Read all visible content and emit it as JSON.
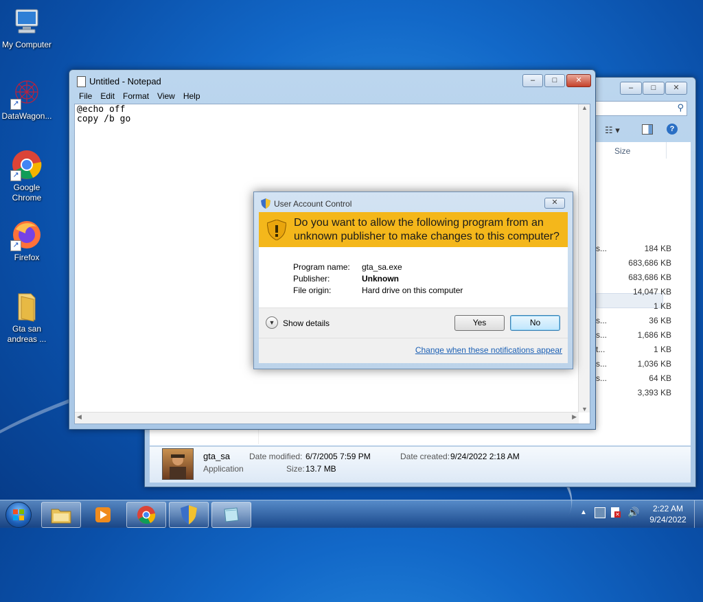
{
  "desktop": {
    "icons": [
      {
        "label": "My Computer",
        "icon": "computer-icon"
      },
      {
        "label": "DataWagon...",
        "icon": "datawagon-icon"
      },
      {
        "label": "Google Chrome",
        "icon": "chrome-icon"
      },
      {
        "label": "Firefox",
        "icon": "firefox-icon"
      },
      {
        "label": "Gta san andreas ...",
        "icon": "folder-icon"
      }
    ]
  },
  "notepad": {
    "title": "Untitled - Notepad",
    "menu": [
      "File",
      "Edit",
      "Format",
      "View",
      "Help"
    ],
    "content": "@echo off\ncopy /b go"
  },
  "explorer": {
    "column_size": "Size",
    "rows": [
      {
        "prefix": "s...",
        "size": "184 KB"
      },
      {
        "prefix": "",
        "size": "683,686 KB"
      },
      {
        "prefix": "",
        "size": "683,686 KB"
      },
      {
        "prefix": "",
        "size": "14,047 KB"
      },
      {
        "prefix": "",
        "size": "1 KB"
      },
      {
        "prefix": "s...",
        "size": "36 KB"
      },
      {
        "prefix": "s...",
        "size": "1,686 KB"
      },
      {
        "prefix": "t...",
        "size": "1 KB"
      },
      {
        "prefix": "s...",
        "size": "1,036 KB"
      },
      {
        "prefix": "s...",
        "size": "64 KB"
      },
      {
        "prefix": "",
        "size": "3,393 KB"
      }
    ],
    "details": {
      "name": "gta_sa",
      "type": "Application",
      "date_modified_label": "Date modified:",
      "date_modified": "6/7/2005 7:59 PM",
      "date_created_label": "Date created:",
      "date_created": "9/24/2022 2:18 AM",
      "size_label": "Size:",
      "size": "13.7 MB"
    }
  },
  "uac": {
    "title": "User Account Control",
    "question": "Do you want to allow the following program from an unknown publisher to make changes to this computer?",
    "program_name_label": "Program name:",
    "program_name": "gta_sa.exe",
    "publisher_label": "Publisher:",
    "publisher": "Unknown",
    "file_origin_label": "File origin:",
    "file_origin": "Hard drive on this computer",
    "show_details": "Show details",
    "yes": "Yes",
    "no": "No",
    "change_link": "Change when these notifications appear"
  },
  "taskbar": {
    "clock_time": "2:22 AM",
    "clock_date": "9/24/2022"
  },
  "colors": {
    "uac_banner": "#f4b71b",
    "link": "#1a5fb4"
  }
}
